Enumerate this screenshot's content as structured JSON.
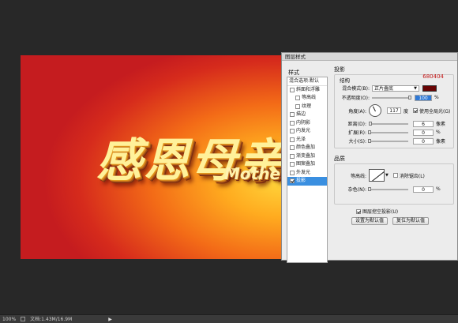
{
  "canvas": {
    "title_text": "感恩母亲",
    "subtitle_text": "Mothe"
  },
  "status": {
    "zoom": "100%",
    "doc": "文档:1.43M/16.9M"
  },
  "dialog": {
    "title": "图层样式",
    "styles_header": "样式",
    "styles": [
      {
        "label": "混合选项:默认",
        "type": "top"
      },
      {
        "label": "斜面和浮雕",
        "checked": false
      },
      {
        "label": "等高线",
        "checked": false,
        "indent": true
      },
      {
        "label": "纹理",
        "checked": false,
        "indent": true
      },
      {
        "label": "描边",
        "checked": false
      },
      {
        "label": "内阴影",
        "checked": false
      },
      {
        "label": "内发光",
        "checked": false
      },
      {
        "label": "光泽",
        "checked": false
      },
      {
        "label": "颜色叠加",
        "checked": false
      },
      {
        "label": "渐变叠加",
        "checked": false
      },
      {
        "label": "图案叠加",
        "checked": false
      },
      {
        "label": "外发光",
        "checked": false
      },
      {
        "label": "投影",
        "checked": true,
        "active": true
      }
    ],
    "shadow": {
      "group_title": "投影",
      "sub_title": "结构",
      "color_hex": "680404",
      "color": "#680404",
      "blend_label": "混合模式(B):",
      "blend_value": "正片叠底",
      "opacity_label": "不透明度(O):",
      "opacity": "100",
      "opacity_unit": "%",
      "angle_label": "角度(A):",
      "angle": "117",
      "angle_unit": "度",
      "global_light_label": "使用全局光(G)",
      "distance_label": "距离(D):",
      "distance": "6",
      "distance_unit": "像素",
      "spread_label": "扩展(R):",
      "spread": "0",
      "spread_unit": "%",
      "size_label": "大小(S):",
      "size": "0",
      "size_unit": "像素"
    },
    "quality": {
      "group_title": "品质",
      "contour_label": "等高线:",
      "antialias_label": "消除锯齿(L)",
      "noise_label": "杂色(N):",
      "noise": "0",
      "noise_unit": "%",
      "knockout_label": "图层挖空投影(U)",
      "make_default": "设置为默认值",
      "reset_default": "复位为默认值"
    }
  }
}
